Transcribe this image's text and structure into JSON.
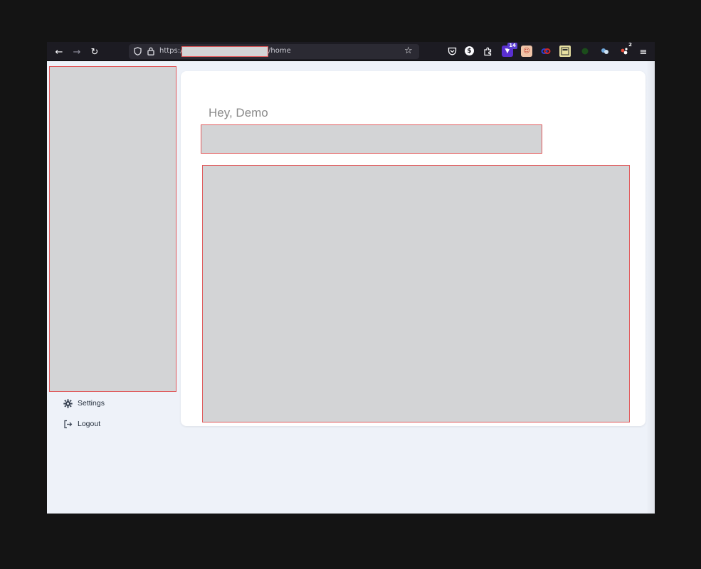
{
  "browser": {
    "url_prefix": "https://",
    "url_suffix": "/home",
    "toolbar": {
      "back_label": "←",
      "forward_label": "→",
      "reload_label": "↻",
      "menu_label": "≡",
      "star_label": "☆"
    },
    "extensions": [
      {
        "name": "pocket-icon",
        "glyph": "◫",
        "color": "#1c1b22"
      },
      {
        "name": "dollar-extension-icon",
        "glyph": "$",
        "color": "#fbfbfe"
      },
      {
        "name": "puzzle-extension-icon",
        "glyph": "⧉",
        "color": "#1c1b22"
      },
      {
        "name": "purple-extension-icon",
        "glyph": "▼",
        "color": "#5a2fd1",
        "badge": "14"
      },
      {
        "name": "face-extension-icon",
        "glyph": "☺",
        "color": "#e26a5a"
      },
      {
        "name": "red-blue-extension-icon",
        "glyph": "∞",
        "color": "#1c1b22"
      },
      {
        "name": "yellow-extension-icon",
        "glyph": "▤",
        "color": "#e7e0a1"
      },
      {
        "name": "green-extension-icon",
        "glyph": "◆",
        "color": "#1c4b1c"
      },
      {
        "name": "blue-extension-icon",
        "glyph": "✿",
        "color": "#1c1b22"
      },
      {
        "name": "dots-extension-icon",
        "glyph": "⁘",
        "color": "#1c1b22",
        "badge": "2"
      }
    ]
  },
  "sidebar": {
    "settings_label": "Settings",
    "logout_label": "Logout"
  },
  "main": {
    "greeting": "Hey, Demo"
  }
}
